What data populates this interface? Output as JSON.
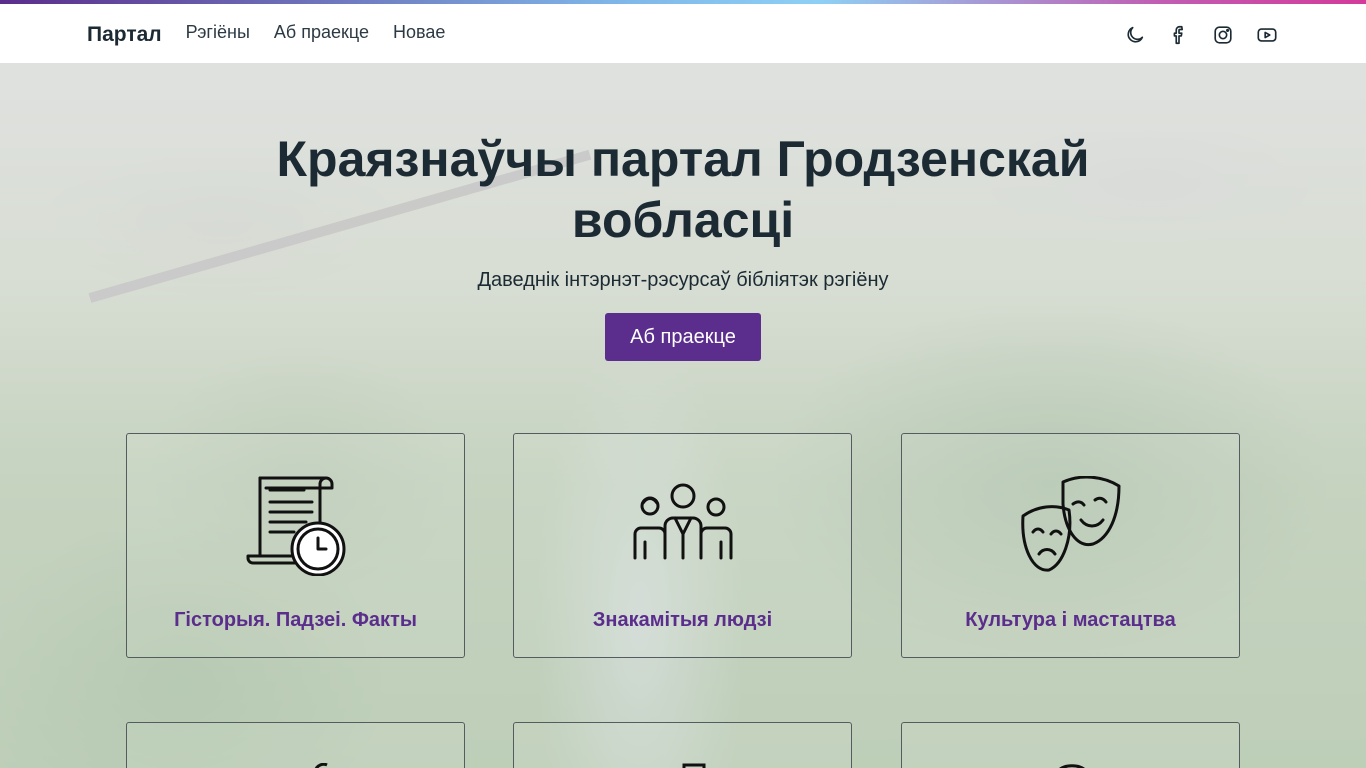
{
  "nav": {
    "brand": "Партал",
    "links": [
      "Рэгіёны",
      "Аб праекце",
      "Новае"
    ],
    "icons": [
      "moon-icon",
      "facebook-icon",
      "instagram-icon",
      "youtube-icon"
    ]
  },
  "hero": {
    "title": "Краязнаўчы партал Гродзенскай вобласці",
    "subtitle": "Даведнік інтэрнэт-рэсурсаў бібліятэк рэгіёну",
    "button": "Аб праекце"
  },
  "cards": [
    {
      "label": "Гісторыя. Падзеі. Факты",
      "icon": "scroll-clock-icon"
    },
    {
      "label": "Знакамітыя людзі",
      "icon": "people-group-icon"
    },
    {
      "label": "Культура і мастацтва",
      "icon": "theater-masks-icon"
    }
  ],
  "colors": {
    "accent": "#5b2d8c",
    "text": "#1b2a33"
  }
}
